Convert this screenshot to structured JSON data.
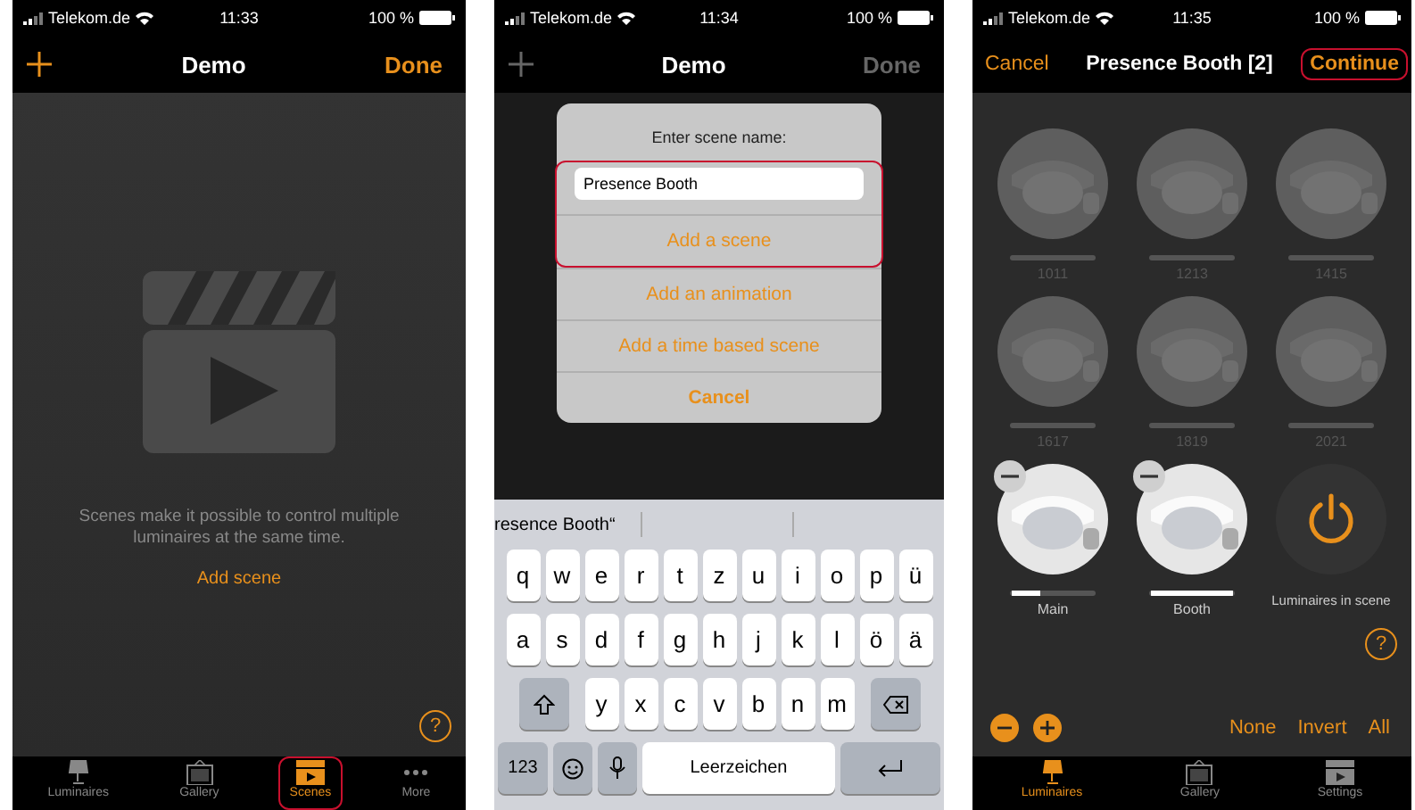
{
  "screen_1": {
    "status_bar": {
      "carrier": "Telekom.de",
      "time": "11:33",
      "battery": "100 %"
    },
    "nav": {
      "title": "Demo",
      "done": "Done",
      "disabled": false
    },
    "help": "?",
    "empty_text": "Scenes make it possible to control multiple luminaires at the same time.",
    "add_link": "Add scene",
    "tabs": [
      {
        "label": "Luminaires",
        "selected": false,
        "highlighted": false
      },
      {
        "label": "Gallery",
        "selected": false,
        "highlighted": false
      },
      {
        "label": "Scenes",
        "selected": true,
        "highlighted": true
      },
      {
        "label": "More",
        "selected": false,
        "highlighted": false
      }
    ]
  },
  "screen_2": {
    "status_bar": {
      "carrier": "Telekom.de",
      "time": "11:34",
      "battery": "100 %"
    },
    "nav": {
      "title": "Demo",
      "done": "Done",
      "disabled": true
    },
    "dialog": {
      "prompt": "Enter scene name:",
      "value": "Presence Booth",
      "highlighted": true,
      "actions": [
        {
          "label": "Add a scene",
          "bold": false
        },
        {
          "label": "Add an animation",
          "bold": false
        },
        {
          "label": "Add a time based scene",
          "bold": false
        },
        {
          "label": "Cancel",
          "bold": true
        }
      ]
    },
    "suggestion": "resence Booth“",
    "key_rows": [
      [
        "q",
        "w",
        "e",
        "r",
        "t",
        "z",
        "u",
        "i",
        "o",
        "p",
        "ü"
      ],
      [
        "a",
        "s",
        "d",
        "f",
        "g",
        "h",
        "j",
        "k",
        "l",
        "ö",
        "ä"
      ],
      [
        "y",
        "x",
        "c",
        "v",
        "b",
        "n",
        "m"
      ]
    ],
    "keys_bottom": {
      "numbers": "123",
      "space": "Leerzeichen"
    }
  },
  "screen_3": {
    "status_bar": {
      "carrier": "Telekom.de",
      "time": "11:35",
      "battery": "100 %"
    },
    "nav": {
      "cancel": "Cancel",
      "title": "Presence Booth [2]",
      "continue": "Continue",
      "highlighted": true
    },
    "tiles": [
      {
        "kind": "luminaire",
        "name": "1011",
        "in_scene": false
      },
      {
        "kind": "luminaire",
        "name": "1213",
        "in_scene": false
      },
      {
        "kind": "luminaire",
        "name": "1415",
        "in_scene": false
      },
      {
        "kind": "luminaire",
        "name": "1617",
        "in_scene": false
      },
      {
        "kind": "luminaire",
        "name": "1819",
        "in_scene": false
      },
      {
        "kind": "luminaire",
        "name": "2021",
        "in_scene": false
      },
      {
        "kind": "luminaire",
        "name": "Main",
        "in_scene": true,
        "level": 0.35
      },
      {
        "kind": "luminaire",
        "name": "Booth",
        "in_scene": true,
        "level": 1
      },
      {
        "kind": "power",
        "name": "Luminaires in scene"
      }
    ],
    "help": "?",
    "select_buttons": [
      "None",
      "Invert",
      "All"
    ],
    "tabs": [
      {
        "label": "Luminaires",
        "selected": true,
        "highlighted": false
      },
      {
        "label": "Gallery",
        "selected": false,
        "highlighted": false
      },
      {
        "label": "Settings",
        "selected": false,
        "highlighted": false
      }
    ]
  }
}
